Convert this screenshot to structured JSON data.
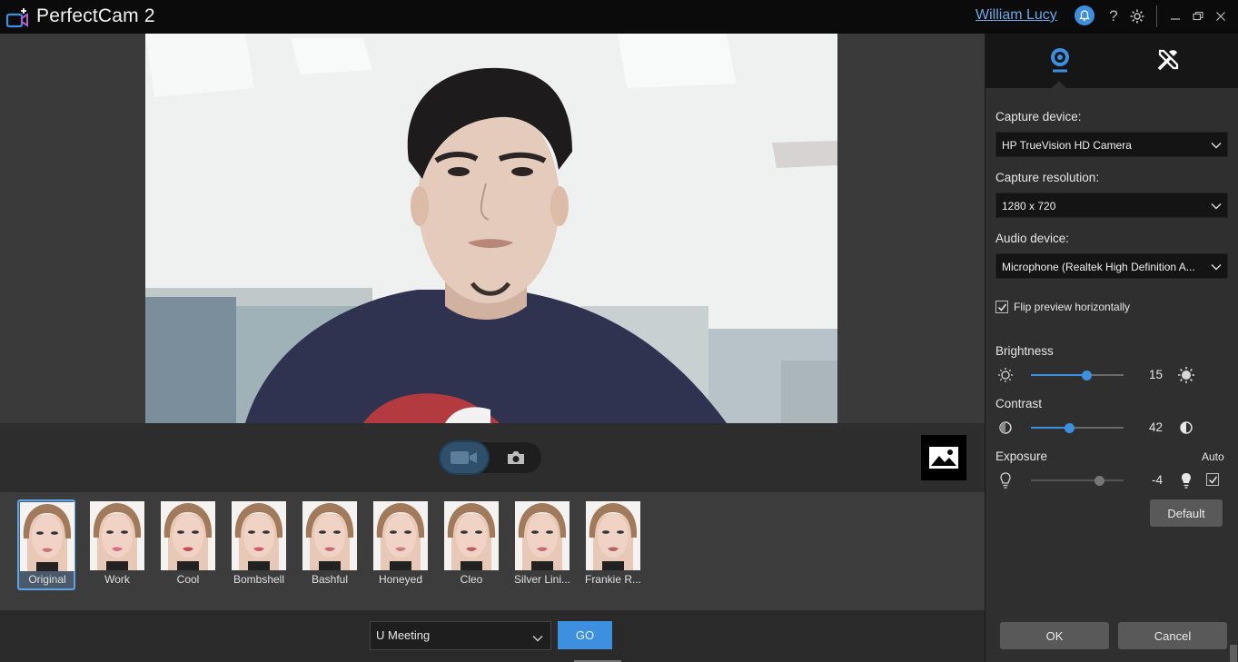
{
  "app": {
    "title": "PerfectCam 2",
    "user": "William Lucy"
  },
  "icons": {
    "logo": "camera-plus-icon",
    "bell": "bell-icon",
    "help": "help-icon",
    "settings": "gear-icon",
    "minimize": "minimize-icon",
    "restore": "restore-icon",
    "close": "close-icon",
    "webcam_tab": "webcam-icon",
    "tools_tab": "tools-icon",
    "video_mode": "video-camera-icon",
    "photo_mode": "photo-camera-icon",
    "gallery": "gallery-icon"
  },
  "colors": {
    "accent": "#3d8fe0",
    "link": "#6aa8e8"
  },
  "filters": [
    {
      "label": "Original",
      "selected": true
    },
    {
      "label": "Work"
    },
    {
      "label": "Cool"
    },
    {
      "label": "Bombshell"
    },
    {
      "label": "Bashful"
    },
    {
      "label": "Honeyed"
    },
    {
      "label": "Cleo"
    },
    {
      "label": "Silver Lini..."
    },
    {
      "label": "Frankie R..."
    }
  ],
  "bottom": {
    "meeting": "U Meeting",
    "go_label": "GO"
  },
  "settings": {
    "capture_device_label": "Capture device:",
    "capture_device": "HP TrueVision HD Camera",
    "capture_resolution_label": "Capture resolution:",
    "capture_resolution": "1280 x 720",
    "audio_device_label": "Audio device:",
    "audio_device": "Microphone (Realtek High Definition A...",
    "flip_label": "Flip preview horizontally",
    "flip_checked": true,
    "brightness_label": "Brightness",
    "brightness_value": "15",
    "brightness_level": 0.6,
    "contrast_label": "Contrast",
    "contrast_value": "42",
    "contrast_level": 0.42,
    "exposure_label": "Exposure",
    "exposure_value": "-4",
    "exposure_level": 0.74,
    "auto_label": "Auto",
    "auto_checked": true,
    "default_label": "Default",
    "ok_label": "OK",
    "cancel_label": "Cancel"
  }
}
